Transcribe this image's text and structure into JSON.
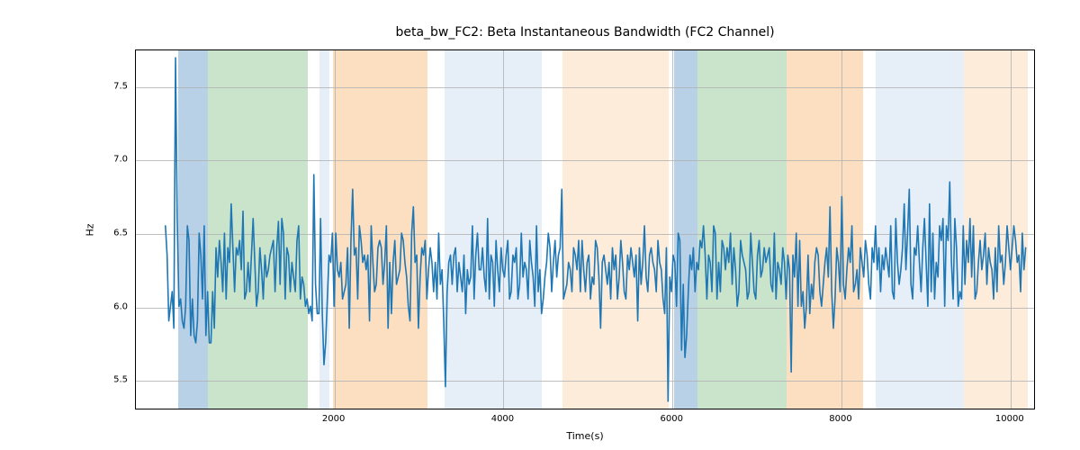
{
  "chart_data": {
    "type": "line",
    "title": "beta_bw_FC2: Beta Instantaneous Bandwidth (FC2 Channel)",
    "xlabel": "Time(s)",
    "ylabel": "Hz",
    "xlim": [
      -350,
      10300
    ],
    "ylim": [
      5.3,
      7.75
    ],
    "xticks": [
      2000,
      4000,
      6000,
      8000,
      10000
    ],
    "yticks": [
      5.5,
      6.0,
      6.5,
      7.0,
      7.5
    ],
    "line_color": "#1f77b4",
    "spans": [
      {
        "start": 150,
        "end": 500,
        "color": "#b9d1e6"
      },
      {
        "start": 500,
        "end": 1680,
        "color": "#c9e4cb"
      },
      {
        "start": 1820,
        "end": 1940,
        "color": "#e6eff8"
      },
      {
        "start": 1980,
        "end": 3100,
        "color": "#fbdfc0"
      },
      {
        "start": 3300,
        "end": 4450,
        "color": "#e6eff8"
      },
      {
        "start": 4700,
        "end": 5960,
        "color": "#fdecda"
      },
      {
        "start": 6020,
        "end": 6300,
        "color": "#b9d1e6"
      },
      {
        "start": 6300,
        "end": 7350,
        "color": "#c9e4cb"
      },
      {
        "start": 7350,
        "end": 8250,
        "color": "#fbdfc0"
      },
      {
        "start": 8400,
        "end": 9450,
        "color": "#e6eff8"
      },
      {
        "start": 9450,
        "end": 10200,
        "color": "#fdecda"
      }
    ],
    "x": [
      0,
      20,
      40,
      60,
      80,
      100,
      120,
      140,
      160,
      180,
      200,
      220,
      240,
      260,
      280,
      300,
      320,
      340,
      360,
      380,
      400,
      420,
      440,
      460,
      480,
      500,
      520,
      540,
      560,
      580,
      600,
      620,
      640,
      660,
      680,
      700,
      720,
      740,
      760,
      780,
      800,
      820,
      840,
      860,
      880,
      900,
      920,
      940,
      960,
      980,
      1000,
      1020,
      1040,
      1060,
      1080,
      1100,
      1120,
      1140,
      1160,
      1180,
      1200,
      1220,
      1240,
      1260,
      1280,
      1300,
      1320,
      1340,
      1360,
      1380,
      1400,
      1420,
      1440,
      1460,
      1480,
      1500,
      1520,
      1540,
      1560,
      1580,
      1600,
      1620,
      1640,
      1660,
      1680,
      1700,
      1720,
      1740,
      1760,
      1780,
      1800,
      1820,
      1840,
      1860,
      1880,
      1900,
      1920,
      1940,
      1960,
      1980,
      2000,
      2020,
      2040,
      2060,
      2080,
      2100,
      2120,
      2140,
      2160,
      2180,
      2200,
      2220,
      2240,
      2260,
      2280,
      2300,
      2320,
      2340,
      2360,
      2380,
      2400,
      2420,
      2440,
      2460,
      2480,
      2500,
      2520,
      2540,
      2560,
      2580,
      2600,
      2620,
      2640,
      2660,
      2680,
      2700,
      2720,
      2740,
      2760,
      2780,
      2800,
      2820,
      2840,
      2860,
      2880,
      2900,
      2920,
      2940,
      2960,
      2980,
      3000,
      3020,
      3040,
      3060,
      3080,
      3100,
      3120,
      3140,
      3160,
      3180,
      3200,
      3220,
      3240,
      3260,
      3280,
      3300,
      3320,
      3340,
      3360,
      3380,
      3400,
      3420,
      3440,
      3460,
      3480,
      3500,
      3520,
      3540,
      3560,
      3580,
      3600,
      3620,
      3640,
      3660,
      3680,
      3700,
      3720,
      3740,
      3760,
      3780,
      3800,
      3820,
      3840,
      3860,
      3880,
      3900,
      3920,
      3940,
      3960,
      3980,
      4000,
      4020,
      4040,
      4060,
      4080,
      4100,
      4120,
      4140,
      4160,
      4180,
      4200,
      4220,
      4240,
      4260,
      4280,
      4300,
      4320,
      4340,
      4360,
      4380,
      4400,
      4420,
      4440,
      4460,
      4480,
      4500,
      4520,
      4540,
      4560,
      4580,
      4600,
      4620,
      4640,
      4660,
      4680,
      4700,
      4720,
      4740,
      4760,
      4780,
      4800,
      4820,
      4840,
      4860,
      4880,
      4900,
      4920,
      4940,
      4960,
      4980,
      5000,
      5020,
      5040,
      5060,
      5080,
      5100,
      5120,
      5140,
      5160,
      5180,
      5200,
      5220,
      5240,
      5260,
      5280,
      5300,
      5320,
      5340,
      5360,
      5380,
      5400,
      5420,
      5440,
      5460,
      5480,
      5500,
      5520,
      5540,
      5560,
      5580,
      5600,
      5620,
      5640,
      5660,
      5680,
      5700,
      5720,
      5740,
      5760,
      5780,
      5800,
      5820,
      5840,
      5860,
      5880,
      5900,
      5920,
      5940,
      5960,
      5980,
      6000,
      6020,
      6040,
      6060,
      6080,
      6100,
      6120,
      6140,
      6160,
      6180,
      6200,
      6220,
      6240,
      6260,
      6280,
      6300,
      6320,
      6340,
      6360,
      6380,
      6400,
      6420,
      6440,
      6460,
      6480,
      6500,
      6520,
      6540,
      6560,
      6580,
      6600,
      6620,
      6640,
      6660,
      6680,
      6700,
      6720,
      6740,
      6760,
      6780,
      6800,
      6820,
      6840,
      6860,
      6880,
      6900,
      6920,
      6940,
      6960,
      6980,
      7000,
      7020,
      7040,
      7060,
      7080,
      7100,
      7120,
      7140,
      7160,
      7180,
      7200,
      7220,
      7240,
      7260,
      7280,
      7300,
      7320,
      7340,
      7360,
      7380,
      7400,
      7420,
      7440,
      7460,
      7480,
      7500,
      7520,
      7540,
      7560,
      7580,
      7600,
      7620,
      7640,
      7660,
      7680,
      7700,
      7720,
      7740,
      7760,
      7780,
      7800,
      7820,
      7840,
      7860,
      7880,
      7900,
      7920,
      7940,
      7960,
      7980,
      8000,
      8020,
      8040,
      8060,
      8080,
      8100,
      8120,
      8140,
      8160,
      8180,
      8200,
      8220,
      8240,
      8260,
      8280,
      8300,
      8320,
      8340,
      8360,
      8380,
      8400,
      8420,
      8440,
      8460,
      8480,
      8500,
      8520,
      8540,
      8560,
      8580,
      8600,
      8620,
      8640,
      8660,
      8680,
      8700,
      8720,
      8740,
      8760,
      8780,
      8800,
      8820,
      8840,
      8860,
      8880,
      8900,
      8920,
      8940,
      8960,
      8980,
      9000,
      9020,
      9040,
      9060,
      9080,
      9100,
      9120,
      9140,
      9160,
      9180,
      9200,
      9220,
      9240,
      9260,
      9280,
      9300,
      9320,
      9340,
      9360,
      9380,
      9400,
      9420,
      9440,
      9460,
      9480,
      9500,
      9520,
      9540,
      9560,
      9580,
      9600,
      9620,
      9640,
      9660,
      9680,
      9700,
      9720,
      9740,
      9760,
      9780,
      9800,
      9820,
      9840,
      9860,
      9880,
      9900,
      9920,
      9940,
      9960,
      9980,
      10000,
      10020,
      10040,
      10060,
      10080,
      10100,
      10120,
      10140,
      10160,
      10180,
      10200
    ],
    "values": [
      6.55,
      6.35,
      5.9,
      6.0,
      6.1,
      5.85,
      7.7,
      6.6,
      6.0,
      6.05,
      5.9,
      5.85,
      6.0,
      6.55,
      6.45,
      5.8,
      6.05,
      5.8,
      5.75,
      5.9,
      6.5,
      6.35,
      6.05,
      6.55,
      5.8,
      6.1,
      5.75,
      5.75,
      6.1,
      5.85,
      6.4,
      6.2,
      6.45,
      6.3,
      6.1,
      6.5,
      6.05,
      6.4,
      6.3,
      6.7,
      6.4,
      6.1,
      6.4,
      6.35,
      6.45,
      6.25,
      6.65,
      6.05,
      6.1,
      6.3,
      6.1,
      6.35,
      6.6,
      6.3,
      6.0,
      6.1,
      6.4,
      6.25,
      6.05,
      6.35,
      6.2,
      6.25,
      6.35,
      6.4,
      6.45,
      6.1,
      6.4,
      6.58,
      6.15,
      6.6,
      6.5,
      6.05,
      6.4,
      6.35,
      6.1,
      6.3,
      6.2,
      6.1,
      6.45,
      6.55,
      6.05,
      6.2,
      6.15,
      6.0,
      6.05,
      5.95,
      6.0,
      5.9,
      6.9,
      6.15,
      5.95,
      5.95,
      6.6,
      5.95,
      5.6,
      5.75,
      6.05,
      6.35,
      6.3,
      6.5,
      6.0,
      6.5,
      6.25,
      6.2,
      6.3,
      6.05,
      6.1,
      6.15,
      6.4,
      5.85,
      6.45,
      6.8,
      6.35,
      6.4,
      6.05,
      6.55,
      6.45,
      6.3,
      6.35,
      6.25,
      6.35,
      5.9,
      6.55,
      6.3,
      6.1,
      6.15,
      6.4,
      6.45,
      6.4,
      6.15,
      6.3,
      6.55,
      5.85,
      6.3,
      5.95,
      6.3,
      6.45,
      6.15,
      6.2,
      6.25,
      6.5,
      6.45,
      6.3,
      6.2,
      6.0,
      5.9,
      6.5,
      6.68,
      6.3,
      6.35,
      5.85,
      6.2,
      6.4,
      6.35,
      6.45,
      6.05,
      6.25,
      6.4,
      6.3,
      6.1,
      6.3,
      6.05,
      6.5,
      6.15,
      6.25,
      5.9,
      5.45,
      6.1,
      6.3,
      6.35,
      6.15,
      6.35,
      6.4,
      6.1,
      6.3,
      6.2,
      6.1,
      6.35,
      5.95,
      6.25,
      6.15,
      6.2,
      6.55,
      6.05,
      6.35,
      6.5,
      6.25,
      6.25,
      6.4,
      6.2,
      6.1,
      6.6,
      6.05,
      6.35,
      6.3,
      6.0,
      6.45,
      6.25,
      6.1,
      6.4,
      6.25,
      6.2,
      6.35,
      6.45,
      6.05,
      6.1,
      6.35,
      6.3,
      6.4,
      6.05,
      6.15,
      6.5,
      6.2,
      6.3,
      6.25,
      6.05,
      6.45,
      6.3,
      6.2,
      6.0,
      6.55,
      6.1,
      6.25,
      5.95,
      6.05,
      6.2,
      6.3,
      6.5,
      6.4,
      6.1,
      6.3,
      6.45,
      6.2,
      6.35,
      6.4,
      6.8,
      6.05,
      6.1,
      6.15,
      6.3,
      6.25,
      6.1,
      6.4,
      6.35,
      6.25,
      6.45,
      6.1,
      6.45,
      6.25,
      6.1,
      6.3,
      6.35,
      6.05,
      6.2,
      6.15,
      6.45,
      6.4,
      6.2,
      5.85,
      6.3,
      6.35,
      6.25,
      6.15,
      6.3,
      6.05,
      6.4,
      6.25,
      6.35,
      6.05,
      6.2,
      6.45,
      6.3,
      6.1,
      6.05,
      6.35,
      6.25,
      6.4,
      6.3,
      6.2,
      6.35,
      5.9,
      6.4,
      6.15,
      6.3,
      6.55,
      6.2,
      6.1,
      6.35,
      6.4,
      6.3,
      6.25,
      6.1,
      6.45,
      6.3,
      6.25,
      6.05,
      5.95,
      6.4,
      5.35,
      6.2,
      6.1,
      6.35,
      6.3,
      6.0,
      6.5,
      6.45,
      5.7,
      6.15,
      5.65,
      5.8,
      6.1,
      6.35,
      6.25,
      6.4,
      6.1,
      6.3,
      6.25,
      6.45,
      6.4,
      6.55,
      6.35,
      6.05,
      6.35,
      6.3,
      6.1,
      6.55,
      6.5,
      6.05,
      6.3,
      6.1,
      6.45,
      6.4,
      6.25,
      6.4,
      6.3,
      6.5,
      6.15,
      6.4,
      6.25,
      6.0,
      6.1,
      6.45,
      6.35,
      6.3,
      6.25,
      6.05,
      6.1,
      6.5,
      6.3,
      6.1,
      6.05,
      6.35,
      6.45,
      6.2,
      6.25,
      6.4,
      6.3,
      6.35,
      6.4,
      6.15,
      6.1,
      6.5,
      6.05,
      6.3,
      6.25,
      6.15,
      6.4,
      6.3,
      6.05,
      6.35,
      6.25,
      5.55,
      6.35,
      6.2,
      6.5,
      6.0,
      6.45,
      6.0,
      6.1,
      5.85,
      6.0,
      6.35,
      5.95,
      6.15,
      6.05,
      6.3,
      6.4,
      6.35,
      6.1,
      6.0,
      6.15,
      6.3,
      6.4,
      6.2,
      6.68,
      6.1,
      5.85,
      6.05,
      6.4,
      6.3,
      6.1,
      6.75,
      6.15,
      6.05,
      6.25,
      6.4,
      6.3,
      6.55,
      6.1,
      6.15,
      6.25,
      6.05,
      6.4,
      6.3,
      6.2,
      6.45,
      6.35,
      6.15,
      6.05,
      6.4,
      6.3,
      6.55,
      6.25,
      6.4,
      6.1,
      6.35,
      6.25,
      6.4,
      6.3,
      6.2,
      6.55,
      6.1,
      6.05,
      6.6,
      6.3,
      6.15,
      6.25,
      6.4,
      6.7,
      6.25,
      6.5,
      6.8,
      6.15,
      6.05,
      6.4,
      6.35,
      6.55,
      6.3,
      6.1,
      6.4,
      6.6,
      6.3,
      6.0,
      6.7,
      6.1,
      6.5,
      6.05,
      6.3,
      6.2,
      6.55,
      6.45,
      6.6,
      6.0,
      6.55,
      6.45,
      6.85,
      6.3,
      6.05,
      6.6,
      6.4,
      6.0,
      6.1,
      6.05,
      6.55,
      6.15,
      6.45,
      6.3,
      6.6,
      6.2,
      6.55,
      6.05,
      6.1,
      6.3,
      6.45,
      6.25,
      6.35,
      6.5,
      6.15,
      6.4,
      6.3,
      6.25,
      6.05,
      6.4,
      6.1,
      6.55,
      6.3,
      6.35,
      6.15,
      6.3,
      6.55,
      6.4,
      6.25,
      6.4,
      6.55,
      6.45,
      6.3,
      6.35,
      6.1,
      6.5,
      6.25,
      6.4,
      6.5
    ]
  }
}
